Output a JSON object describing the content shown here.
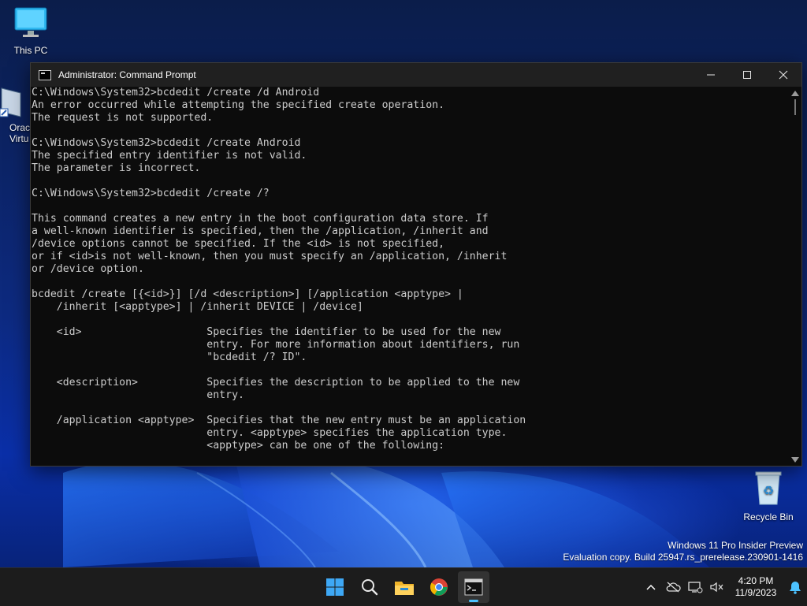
{
  "desktop": {
    "icons": [
      {
        "label": "This PC"
      },
      {
        "label": "Oracl\nVirtu"
      },
      {
        "label": "Recycle Bin"
      }
    ],
    "watermark": {
      "line1": "Windows 11 Pro Insider Preview",
      "line2": "Evaluation copy. Build 25947.rs_prerelease.230901-1416"
    }
  },
  "window": {
    "title": "Administrator: Command Prompt",
    "console_text": "C:\\Windows\\System32>bcdedit /create /d Android\nAn error occurred while attempting the specified create operation.\nThe request is not supported.\n\nC:\\Windows\\System32>bcdedit /create Android\nThe specified entry identifier is not valid.\nThe parameter is incorrect.\n\nC:\\Windows\\System32>bcdedit /create /?\n\nThis command creates a new entry in the boot configuration data store. If\na well-known identifier is specified, then the /application, /inherit and\n/device options cannot be specified. If the <id> is not specified,\nor if <id>is not well-known, then you must specify an /application, /inherit\nor /device option.\n\nbcdedit /create [{<id>}] [/d <description>] [/application <apptype> |\n    /inherit [<apptype>] | /inherit DEVICE | /device]\n\n    <id>                    Specifies the identifier to be used for the new\n                            entry. For more information about identifiers, run\n                            \"bcdedit /? ID\".\n\n    <description>           Specifies the description to be applied to the new\n                            entry.\n\n    /application <apptype>  Specifies that the new entry must be an application\n                            entry. <apptype> specifies the application type.\n                            <apptype> can be one of the following:"
  },
  "taskbar": {
    "apps": [
      "start-icon",
      "search-icon",
      "file-explorer-icon",
      "chrome-icon",
      "terminal-icon"
    ],
    "clock": {
      "time": "4:20 PM",
      "date": "11/9/2023"
    }
  },
  "colors": {
    "accent": "#4cc2ff",
    "console_bg": "#0c0c0c",
    "console_fg": "#cccccc",
    "titlebar": "#202020",
    "taskbar": "#1c1c1c"
  }
}
